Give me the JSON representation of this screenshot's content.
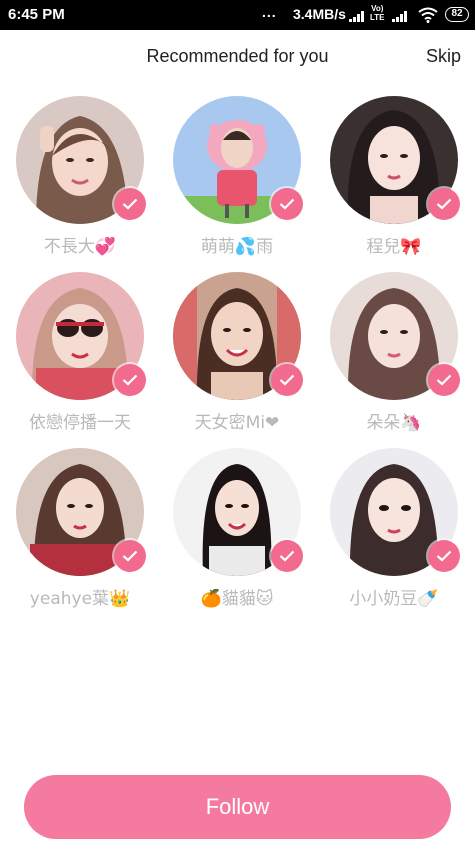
{
  "status_bar": {
    "time": "6:45 PM",
    "dots": "...",
    "speed": "3.4MB/s",
    "volte_top": "Vo)",
    "volte_bottom": "LTE",
    "battery": "82"
  },
  "header": {
    "title": "Recommended for you",
    "skip_label": "Skip"
  },
  "users": [
    {
      "name": "不長大💞",
      "selected": true,
      "icon": "avatar-photo"
    },
    {
      "name": "萌萌💦雨",
      "selected": true,
      "icon": "avatar-photo"
    },
    {
      "name": "程兒🎀",
      "selected": true,
      "icon": "avatar-photo"
    },
    {
      "name": "依戀停播一天",
      "selected": true,
      "icon": "avatar-photo"
    },
    {
      "name": "天女密Mi❤",
      "selected": true,
      "icon": "avatar-photo"
    },
    {
      "name": "朵朵🦄",
      "selected": true,
      "icon": "avatar-photo"
    },
    {
      "name": "yeahye葉👑",
      "selected": true,
      "icon": "avatar-photo"
    },
    {
      "name": "🍊貓貓🐱",
      "selected": true,
      "icon": "avatar-photo"
    },
    {
      "name": "小小奶豆🍼",
      "selected": true,
      "icon": "avatar-photo"
    }
  ],
  "follow_label": "Follow",
  "colors": {
    "accent": "#f26b8f",
    "button": "#f47aa0",
    "name_text": "#b9b9b9"
  }
}
